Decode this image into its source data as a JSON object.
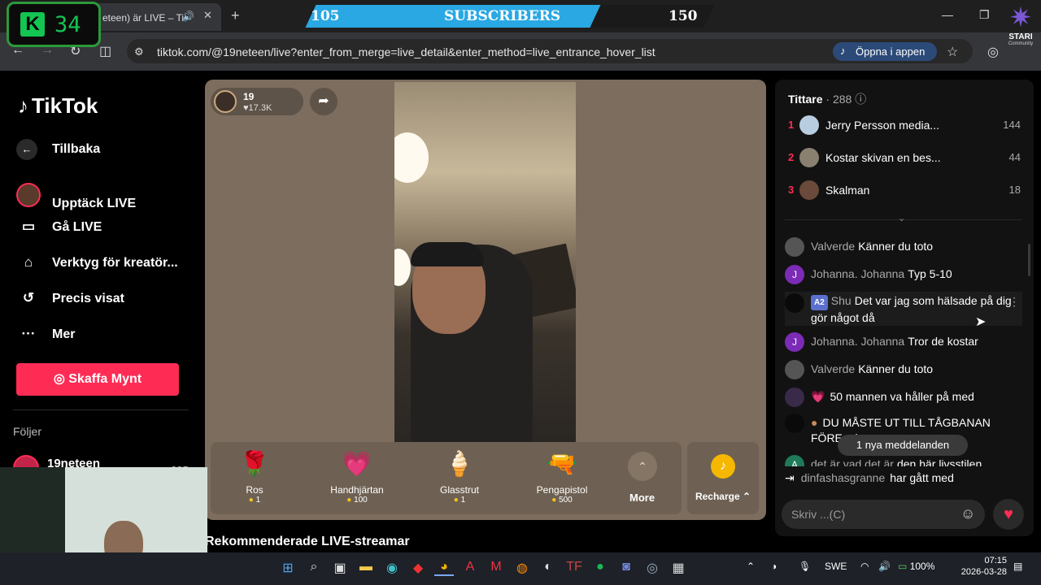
{
  "browser": {
    "tab_title": "eteen) är LIVE – Ti",
    "url": "tiktok.com/@19neteen/live?enter_from_merge=live_detail&enter_method=live_entrance_hover_list",
    "open_app": "Öppna i appen"
  },
  "overlay": {
    "k_letter": "K",
    "counter": "34",
    "sub_current": "105",
    "sub_label": "SUBSCRIBERS",
    "sub_goal": "150",
    "brand": "STARI",
    "brand_sub": "Community"
  },
  "sidebar": {
    "logo": "TikTok",
    "back": "Tillbaka",
    "items": [
      {
        "label": "Upptäck LIVE",
        "icon": "live-avatar-icon"
      },
      {
        "label": "Gå LIVE",
        "icon": "video-camera-icon"
      },
      {
        "label": "Verktyg för kreatör...",
        "icon": "creator-tools-icon"
      },
      {
        "label": "Precis visat",
        "icon": "history-icon"
      },
      {
        "label": "Mer",
        "icon": "more-icon"
      }
    ],
    "cta": "Skaffa Mynt",
    "following_title": "Följer",
    "following": [
      {
        "name": "19neteen",
        "count": "285"
      }
    ]
  },
  "stream": {
    "host_name": "19",
    "host_likes": "17.3K",
    "gifts": [
      {
        "name": "Ros",
        "price": "1",
        "icon": "rose-icon"
      },
      {
        "name": "Handhjärtan",
        "price": "100",
        "icon": "hand-hearts-icon"
      },
      {
        "name": "Glasstrut",
        "price": "1",
        "icon": "ice-cream-icon"
      },
      {
        "name": "Pengapistol",
        "price": "500",
        "icon": "money-gun-icon"
      }
    ],
    "more": "More",
    "recharge": "Recharge",
    "recommended": "Rekommenderade LIVE-streamar"
  },
  "chat": {
    "viewers_label": "Tittare",
    "viewers_count": "· 288",
    "top_viewers": [
      {
        "rank": "1",
        "name": "Jerry Persson media...",
        "score": "144"
      },
      {
        "rank": "2",
        "name": "Kostar skivan en bes...",
        "score": "44"
      },
      {
        "rank": "3",
        "name": "Skalman",
        "score": "18"
      }
    ],
    "messages": [
      {
        "user": "Valverde",
        "text": "Känner du toto"
      },
      {
        "user": "Johanna. Johanna",
        "text": "Typ 5-10"
      },
      {
        "user": "Shu",
        "badge": "A2",
        "text": "Det var jag som hälsade på dig gör något då"
      },
      {
        "user": "Johanna. Johanna",
        "text": "Tror de kostar"
      },
      {
        "user": "Valverde",
        "text": "Känner du toto"
      },
      {
        "user": "",
        "text": "50 mannen va håller på med"
      },
      {
        "user": "",
        "text": "DU MÅSTE UT TILL TÅGBANAN FÖRE... kr"
      },
      {
        "user": "det är vad det är",
        "text": "den här livsstilen"
      }
    ],
    "new_messages": "1 nya meddelanden",
    "joined_user": "dinfashasgranne",
    "joined_text": "har gått med",
    "input_placeholder": "Skriv ...(C)"
  },
  "taskbar": {
    "lang": "SWE",
    "battery": "100%",
    "time": "07:15",
    "date": "2026-03-28"
  }
}
